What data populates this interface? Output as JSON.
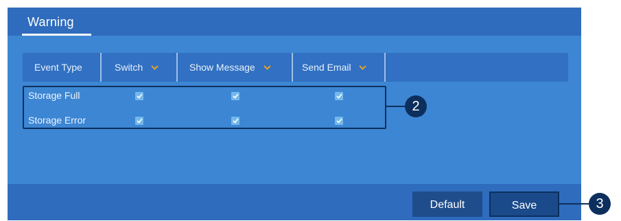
{
  "tabs": [
    {
      "label": "Warning",
      "active": true
    }
  ],
  "table": {
    "columns": [
      {
        "label": "Event Type",
        "has_dropdown": false
      },
      {
        "label": "Switch",
        "has_dropdown": true
      },
      {
        "label": "Show Message",
        "has_dropdown": true
      },
      {
        "label": "Send Email",
        "has_dropdown": true
      }
    ],
    "rows": [
      {
        "label": "Storage Full",
        "switch": true,
        "show_message": true,
        "send_email": true
      },
      {
        "label": "Storage Error",
        "switch": true,
        "show_message": true,
        "send_email": true
      }
    ]
  },
  "footer": {
    "default_label": "Default",
    "save_label": "Save"
  },
  "callouts": [
    {
      "label": "2"
    },
    {
      "label": "3"
    }
  ],
  "colors": {
    "panel": "#3d86d3",
    "bar": "#2f6cbd",
    "button": "#1f4d8c",
    "callout": "#0d2f5e",
    "dropdown_chevron": "#f0a020",
    "checkbox": "#74b8ec"
  },
  "icons": {
    "dropdown": "chevron-down-icon",
    "checkbox": "checkmark-icon"
  }
}
